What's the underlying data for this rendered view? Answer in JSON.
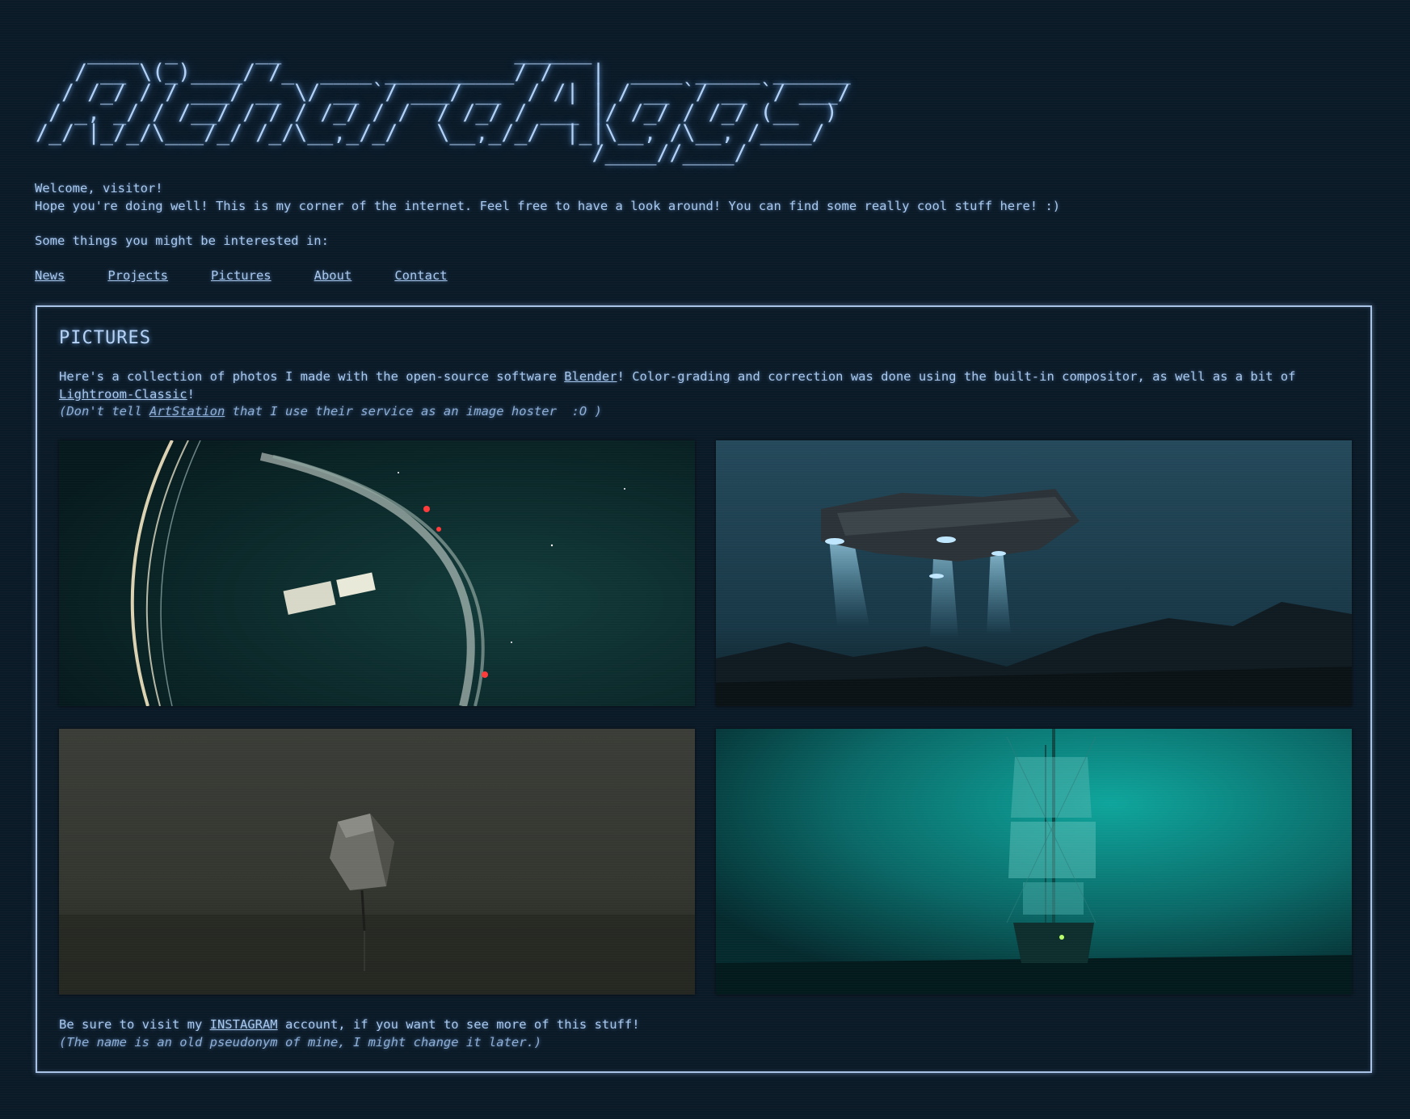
{
  "logo_ascii": "    ____  _      __                  ______\n   / __ \\(_)____/ /_  ____ __________/ /   |  ____ _____ ______\n  / /_/ / / ___/ __ \\/ __ `/ ___/ __  / /| | / __ `/ __ `/ ___/\n / _, _/ / /__/ / / / /_/ / /  / /_/ / ___ |/ /_/ / /_/ (__  )\n/_/ |_/_/\\___/_/ /_/\\__,_/_/   \\__,_/_/  |_|\\__, /\\__, /____/\n                                           /____//____/",
  "intro": {
    "welcome": "Welcome, visitor!",
    "hope": "Hope you're doing well! This is my corner of the internet. Feel free to have a look around! You can find some really cool stuff here! :)",
    "interested": "Some things you might be interested in:"
  },
  "nav": [
    "News",
    "Projects",
    "Pictures",
    "About",
    "Contact"
  ],
  "panel": {
    "title": "PICTURES",
    "desc_part1": "Here's a collection of photos I made with the open-source software ",
    "blender_link": "Blender",
    "desc_part2": "! Color-grading and correction was done using the built-in compositor, as well as a bit of ",
    "lightroom_link": "Lightroom-Classic",
    "desc_part3": "!",
    "note_part1": "(Don't tell ",
    "artstation_link": "ArtStation",
    "note_part2": " that I use their service as an image hoster  :O )",
    "footer_part1": "Be sure to visit my ",
    "instagram_link": "INSTAGRAM",
    "footer_part2": " account, if you want to see more of this stuff!",
    "footer_note": "(The name is an old pseudonym of mine, I might change it later.)"
  },
  "colors": {
    "background": "#0b1a27",
    "text": "#a9c8ee",
    "border": "#a9c3e6",
    "italic_text": "#8eaed6"
  }
}
